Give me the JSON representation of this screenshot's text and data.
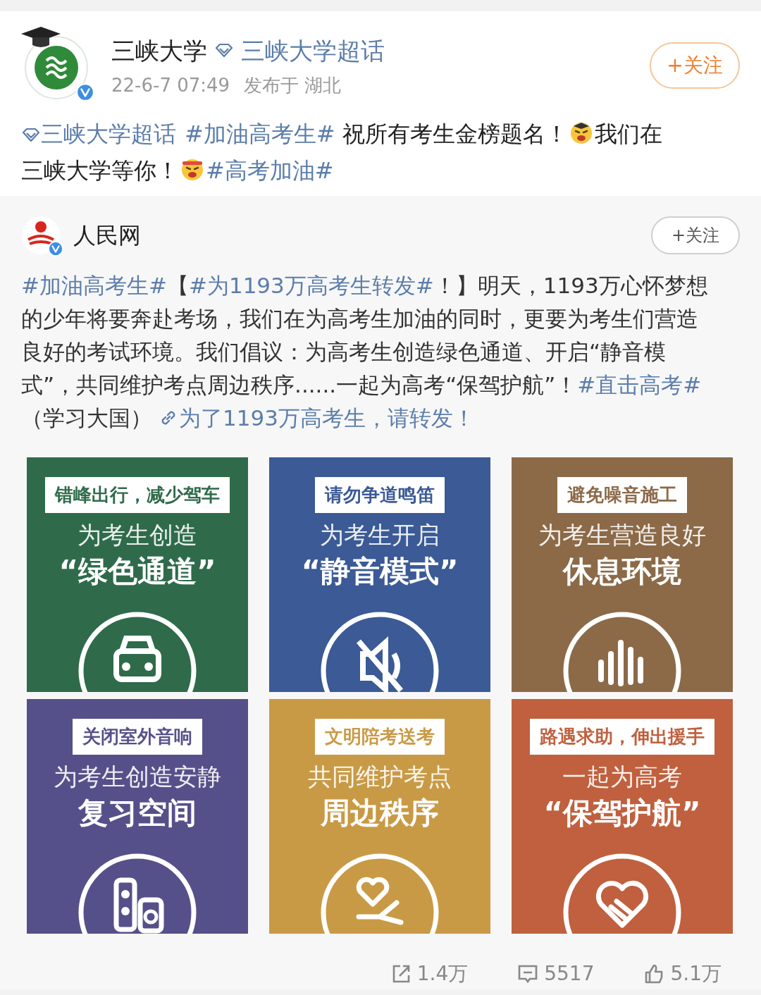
{
  "post": {
    "author": "三峡大学",
    "super_topic": "三峡大学超话",
    "time": "22-6-7 07:49",
    "location": "发布于 湖北",
    "follow_button": "+关注",
    "text": [
      {
        "kind": "supertopic",
        "text": "三峡大学超话"
      },
      {
        "kind": "topic",
        "text": "#加油高考生#"
      },
      {
        "kind": "plain",
        "text": " 祝所有考生金榜题名！"
      },
      {
        "kind": "emoji"
      },
      {
        "kind": "plain",
        "text": "我们在三峡大学等你！"
      },
      {
        "kind": "emoji"
      },
      {
        "kind": "topic",
        "text": "#高考加油#"
      }
    ]
  },
  "repost": {
    "author": "人民网",
    "follow_button": "+关注",
    "text": [
      {
        "kind": "topic",
        "text": "#加油高考生#"
      },
      {
        "kind": "plain",
        "text": "【"
      },
      {
        "kind": "topic",
        "text": "#为1193万高考生转发#"
      },
      {
        "kind": "plain",
        "text": "！】明天，1193万心怀梦想的少年将要奔赴考场，我们在为高考生加油的同时，更要为考生们营造良好的考试环境。我们倡议：为高考生创造绿色通道、开启“静音模式”，共同维护考点周边秩序......一起为高考“保驾护航”！"
      },
      {
        "kind": "topic",
        "text": "#直击高考#"
      },
      {
        "kind": "plain",
        "text": "（学习大国）"
      },
      {
        "kind": "link",
        "text": "为了1193万高考生，请转发！"
      }
    ],
    "tiles": [
      {
        "color": "#2f6b4b",
        "tag": "错峰出行，减少驾车",
        "line1": "为考生创造",
        "line2": "“绿色通道”",
        "kind": "car"
      },
      {
        "color": "#3b5a96",
        "tag": "请勿争道鸣笛",
        "line1": "为考生开启",
        "line2": "“静音模式”",
        "kind": "mute"
      },
      {
        "color": "#8c6a48",
        "tag": "避免噪音施工",
        "line1": "为考生营造良好",
        "line2": "休息环境",
        "kind": "wave"
      },
      {
        "color": "#56508a",
        "tag": "关闭室外音响",
        "line1": "为考生创造安静",
        "line2": "复习空间",
        "kind": "speaker"
      },
      {
        "color": "#c99a45",
        "tag": "文明陪考送考",
        "line1": "共同维护考点",
        "line2": "周边秩序",
        "kind": "hearthand"
      },
      {
        "color": "#c0603e",
        "tag": "路遇求助，伸出援手",
        "line1": "一起为高考",
        "line2": "“保驾护航”",
        "kind": "handshake"
      }
    ],
    "stats": {
      "reposts": "1.4万",
      "comments": "5517",
      "likes": "5.1万"
    }
  }
}
